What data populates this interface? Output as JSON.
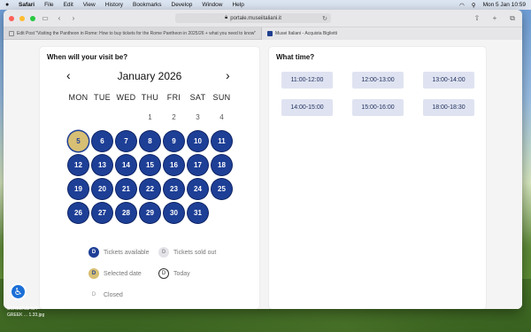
{
  "menubar": {
    "app": "Safari",
    "items": [
      "File",
      "Edit",
      "View",
      "History",
      "Bookmarks",
      "Develop",
      "Window",
      "Help"
    ],
    "datetime": "Mon 5 Jan  10:59"
  },
  "browser": {
    "url": "portale.museiitaliani.it",
    "tabs": [
      {
        "label": "Edit Post \"Visiting the Pantheon in Rome: How to buy tickets for the Rome Pantheon in 2025/26 + what you need to know\""
      },
      {
        "label": "Musei Italiani - Acquista Biglietti"
      }
    ]
  },
  "date_panel": {
    "title": "When will your visit be?",
    "month": "January 2026",
    "weekdays": [
      "MON",
      "TUE",
      "WED",
      "THU",
      "FRI",
      "SAT",
      "SUN"
    ],
    "lead_days": [
      "1",
      "2",
      "3",
      "4"
    ],
    "days": [
      "5",
      "6",
      "7",
      "8",
      "9",
      "10",
      "11",
      "12",
      "13",
      "14",
      "15",
      "16",
      "17",
      "18",
      "19",
      "20",
      "21",
      "22",
      "23",
      "24",
      "25",
      "26",
      "27",
      "28",
      "29",
      "30",
      "31"
    ],
    "selected_day": "5",
    "legend": {
      "available": {
        "glyph": "D",
        "label": "Tickets available"
      },
      "sold_out": {
        "glyph": "D",
        "label": "Tickets sold out"
      },
      "selected": {
        "glyph": "D",
        "label": "Selected date"
      },
      "today": {
        "glyph": "D",
        "label": "Today"
      },
      "closed": {
        "glyph": "D",
        "label": "Closed"
      }
    }
  },
  "time_panel": {
    "title": "What time?",
    "slots": [
      "11:00-12:00",
      "12:00-13:00",
      "13:00-14:00",
      "14:00-15:00",
      "15:00-16:00",
      "18:00-18:30"
    ]
  },
  "desktop": {
    "file_label_1": "SCREENSHOT",
    "file_label_2": "GREEK ... 1.33.jpg"
  },
  "colors": {
    "available": "#1e3f96",
    "selected": "#d7bf74",
    "slot_bg": "#dfe3f1"
  }
}
